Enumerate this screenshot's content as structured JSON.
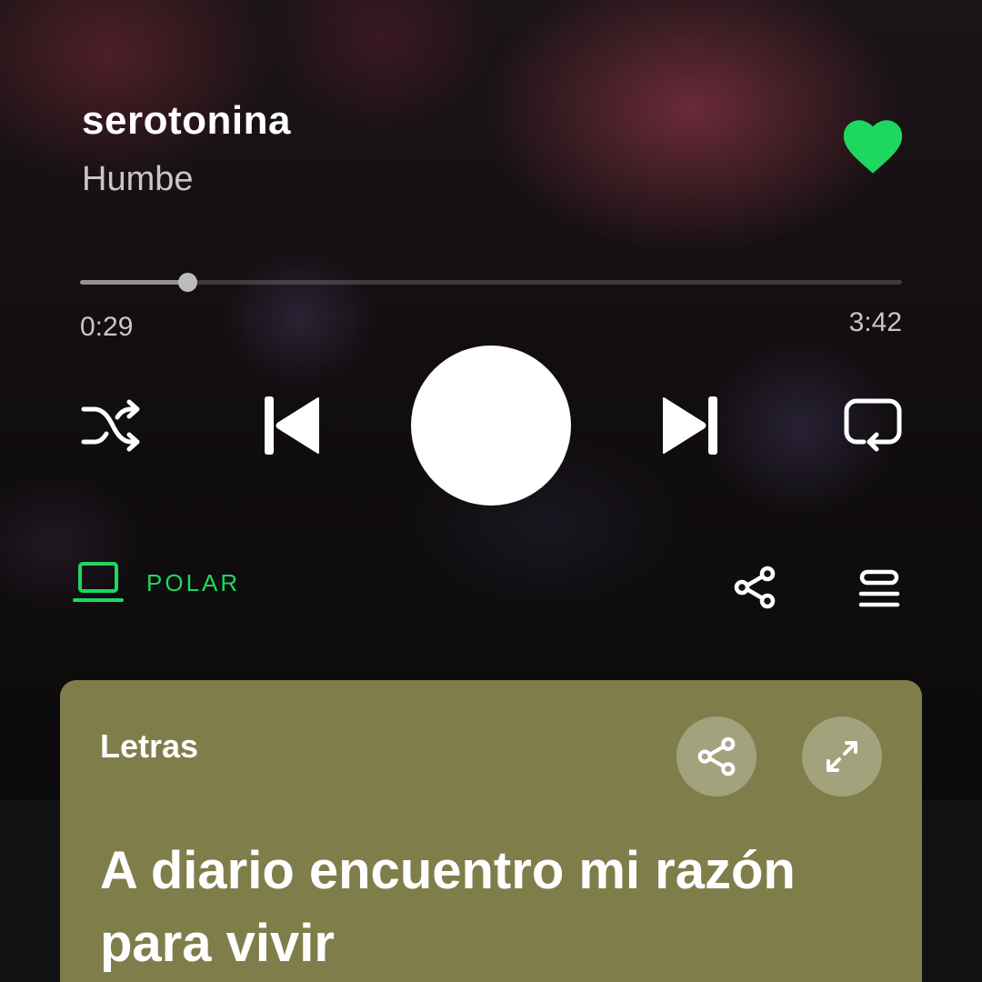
{
  "track": {
    "title": "serotonina",
    "artist": "Humbe",
    "liked": true
  },
  "playback": {
    "elapsed": "0:29",
    "duration": "3:42",
    "progress_fraction": 0.13
  },
  "device": {
    "name": "POLAR"
  },
  "icons": {
    "like": "heart-filled-icon",
    "shuffle": "shuffle-icon",
    "previous": "skip-previous-icon",
    "play": "play-button",
    "next": "skip-next-icon",
    "repeat": "repeat-icon",
    "device": "laptop-icon",
    "share": "share-icon",
    "queue": "queue-icon",
    "expand": "expand-icon"
  },
  "lyrics": {
    "heading": "Letras",
    "current_line": "A diario encuentro mi razón para vivir"
  },
  "colors": {
    "accent": "#1ed760",
    "lyrics_card": "#7f7e4b"
  }
}
